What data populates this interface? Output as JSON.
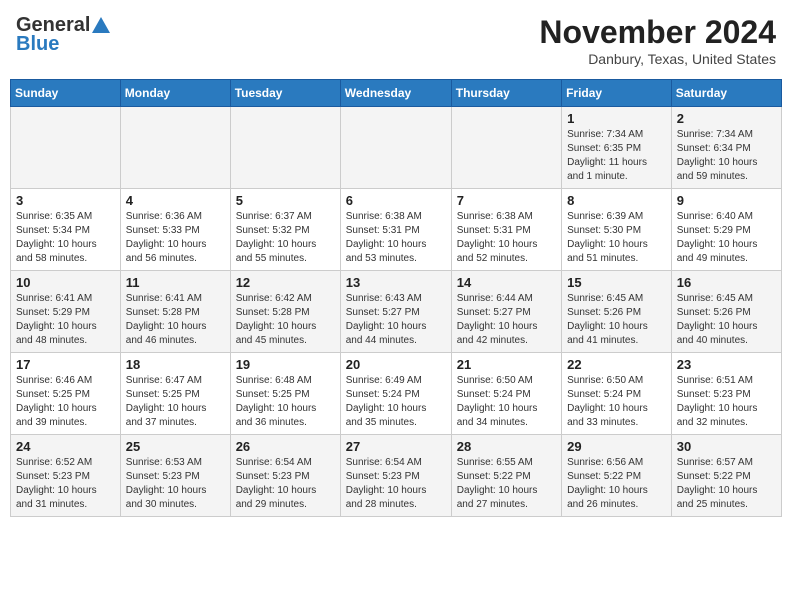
{
  "header": {
    "logo_general": "General",
    "logo_blue": "Blue",
    "title": "November 2024",
    "subtitle": "Danbury, Texas, United States"
  },
  "weekdays": [
    "Sunday",
    "Monday",
    "Tuesday",
    "Wednesday",
    "Thursday",
    "Friday",
    "Saturday"
  ],
  "weeks": [
    [
      {
        "day": "",
        "info": ""
      },
      {
        "day": "",
        "info": ""
      },
      {
        "day": "",
        "info": ""
      },
      {
        "day": "",
        "info": ""
      },
      {
        "day": "",
        "info": ""
      },
      {
        "day": "1",
        "info": "Sunrise: 7:34 AM\nSunset: 6:35 PM\nDaylight: 11 hours\nand 1 minute."
      },
      {
        "day": "2",
        "info": "Sunrise: 7:34 AM\nSunset: 6:34 PM\nDaylight: 10 hours\nand 59 minutes."
      }
    ],
    [
      {
        "day": "3",
        "info": "Sunrise: 6:35 AM\nSunset: 5:34 PM\nDaylight: 10 hours\nand 58 minutes."
      },
      {
        "day": "4",
        "info": "Sunrise: 6:36 AM\nSunset: 5:33 PM\nDaylight: 10 hours\nand 56 minutes."
      },
      {
        "day": "5",
        "info": "Sunrise: 6:37 AM\nSunset: 5:32 PM\nDaylight: 10 hours\nand 55 minutes."
      },
      {
        "day": "6",
        "info": "Sunrise: 6:38 AM\nSunset: 5:31 PM\nDaylight: 10 hours\nand 53 minutes."
      },
      {
        "day": "7",
        "info": "Sunrise: 6:38 AM\nSunset: 5:31 PM\nDaylight: 10 hours\nand 52 minutes."
      },
      {
        "day": "8",
        "info": "Sunrise: 6:39 AM\nSunset: 5:30 PM\nDaylight: 10 hours\nand 51 minutes."
      },
      {
        "day": "9",
        "info": "Sunrise: 6:40 AM\nSunset: 5:29 PM\nDaylight: 10 hours\nand 49 minutes."
      }
    ],
    [
      {
        "day": "10",
        "info": "Sunrise: 6:41 AM\nSunset: 5:29 PM\nDaylight: 10 hours\nand 48 minutes."
      },
      {
        "day": "11",
        "info": "Sunrise: 6:41 AM\nSunset: 5:28 PM\nDaylight: 10 hours\nand 46 minutes."
      },
      {
        "day": "12",
        "info": "Sunrise: 6:42 AM\nSunset: 5:28 PM\nDaylight: 10 hours\nand 45 minutes."
      },
      {
        "day": "13",
        "info": "Sunrise: 6:43 AM\nSunset: 5:27 PM\nDaylight: 10 hours\nand 44 minutes."
      },
      {
        "day": "14",
        "info": "Sunrise: 6:44 AM\nSunset: 5:27 PM\nDaylight: 10 hours\nand 42 minutes."
      },
      {
        "day": "15",
        "info": "Sunrise: 6:45 AM\nSunset: 5:26 PM\nDaylight: 10 hours\nand 41 minutes."
      },
      {
        "day": "16",
        "info": "Sunrise: 6:45 AM\nSunset: 5:26 PM\nDaylight: 10 hours\nand 40 minutes."
      }
    ],
    [
      {
        "day": "17",
        "info": "Sunrise: 6:46 AM\nSunset: 5:25 PM\nDaylight: 10 hours\nand 39 minutes."
      },
      {
        "day": "18",
        "info": "Sunrise: 6:47 AM\nSunset: 5:25 PM\nDaylight: 10 hours\nand 37 minutes."
      },
      {
        "day": "19",
        "info": "Sunrise: 6:48 AM\nSunset: 5:25 PM\nDaylight: 10 hours\nand 36 minutes."
      },
      {
        "day": "20",
        "info": "Sunrise: 6:49 AM\nSunset: 5:24 PM\nDaylight: 10 hours\nand 35 minutes."
      },
      {
        "day": "21",
        "info": "Sunrise: 6:50 AM\nSunset: 5:24 PM\nDaylight: 10 hours\nand 34 minutes."
      },
      {
        "day": "22",
        "info": "Sunrise: 6:50 AM\nSunset: 5:24 PM\nDaylight: 10 hours\nand 33 minutes."
      },
      {
        "day": "23",
        "info": "Sunrise: 6:51 AM\nSunset: 5:23 PM\nDaylight: 10 hours\nand 32 minutes."
      }
    ],
    [
      {
        "day": "24",
        "info": "Sunrise: 6:52 AM\nSunset: 5:23 PM\nDaylight: 10 hours\nand 31 minutes."
      },
      {
        "day": "25",
        "info": "Sunrise: 6:53 AM\nSunset: 5:23 PM\nDaylight: 10 hours\nand 30 minutes."
      },
      {
        "day": "26",
        "info": "Sunrise: 6:54 AM\nSunset: 5:23 PM\nDaylight: 10 hours\nand 29 minutes."
      },
      {
        "day": "27",
        "info": "Sunrise: 6:54 AM\nSunset: 5:23 PM\nDaylight: 10 hours\nand 28 minutes."
      },
      {
        "day": "28",
        "info": "Sunrise: 6:55 AM\nSunset: 5:22 PM\nDaylight: 10 hours\nand 27 minutes."
      },
      {
        "day": "29",
        "info": "Sunrise: 6:56 AM\nSunset: 5:22 PM\nDaylight: 10 hours\nand 26 minutes."
      },
      {
        "day": "30",
        "info": "Sunrise: 6:57 AM\nSunset: 5:22 PM\nDaylight: 10 hours\nand 25 minutes."
      }
    ]
  ]
}
